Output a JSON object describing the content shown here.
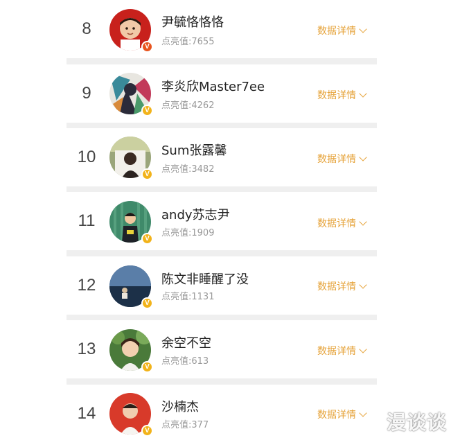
{
  "detail_label": "数据详情",
  "verified_mark": "V",
  "watermark": "漫谈谈",
  "colors": {
    "accent": "#e6a33a",
    "badge_gold": "#f2b31a",
    "badge_red": "#e8541e"
  },
  "entries": [
    {
      "rank": "8",
      "name": "尹毓恪恪恪",
      "score": "点亮值:7655"
    },
    {
      "rank": "9",
      "name": "李炎欣Master7ee",
      "score": "点亮值:4262"
    },
    {
      "rank": "10",
      "name": "Sum张露馨",
      "score": "点亮值:3482"
    },
    {
      "rank": "11",
      "name": "andy苏志尹",
      "score": "点亮值:1909"
    },
    {
      "rank": "12",
      "name": "陈文非睡醒了没",
      "score": "点亮值:1131"
    },
    {
      "rank": "13",
      "name": "余空不空",
      "score": "点亮值:613"
    },
    {
      "rank": "14",
      "name": "沙楠杰",
      "score": "点亮值:377"
    }
  ]
}
